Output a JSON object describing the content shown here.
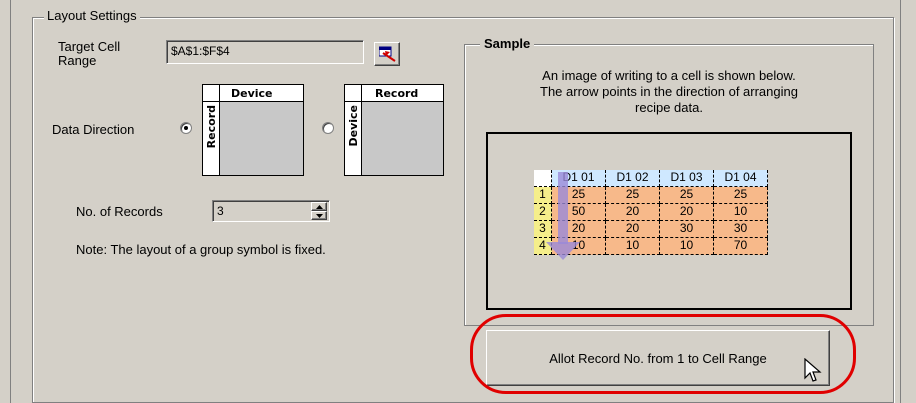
{
  "group": {
    "title": "Layout Settings"
  },
  "target_cell": {
    "label": "Target Cell Range",
    "value": "$A$1:$F$4",
    "button_icon": "range-select-icon"
  },
  "data_direction": {
    "label": "Data Direction",
    "option_record_vertical": {
      "selected": true,
      "header": "Device",
      "side": "Record"
    },
    "option_device_vertical": {
      "selected": false,
      "header": "Record",
      "side": "Device"
    }
  },
  "records": {
    "label": "No. of Records",
    "value": "3"
  },
  "note": "Note: The layout of a group symbol is fixed.",
  "sample": {
    "title": "Sample",
    "description_line1": "An image of writing to a cell is shown below.",
    "description_line2": "The arrow points in the direction of arranging",
    "description_line3": "recipe data.",
    "grid": {
      "header": [
        "",
        "D1 01",
        "D1 02",
        "D1 03",
        "D1 04"
      ],
      "rows": [
        [
          "1",
          "25",
          "25",
          "25",
          "25"
        ],
        [
          "2",
          "50",
          "20",
          "20",
          "10"
        ],
        [
          "3",
          "20",
          "20",
          "30",
          "30"
        ],
        [
          "4",
          "10",
          "10",
          "10",
          "70"
        ]
      ]
    }
  },
  "allot_button": {
    "label": "Allot Record No. from 1 to Cell Range"
  },
  "colors": {
    "highlight": "#e00000",
    "data_cell": "#f7b98a",
    "index_cell": "#f5ee8a",
    "header_cell": "#cfe8ff",
    "arrow": "#9a8ad8"
  }
}
